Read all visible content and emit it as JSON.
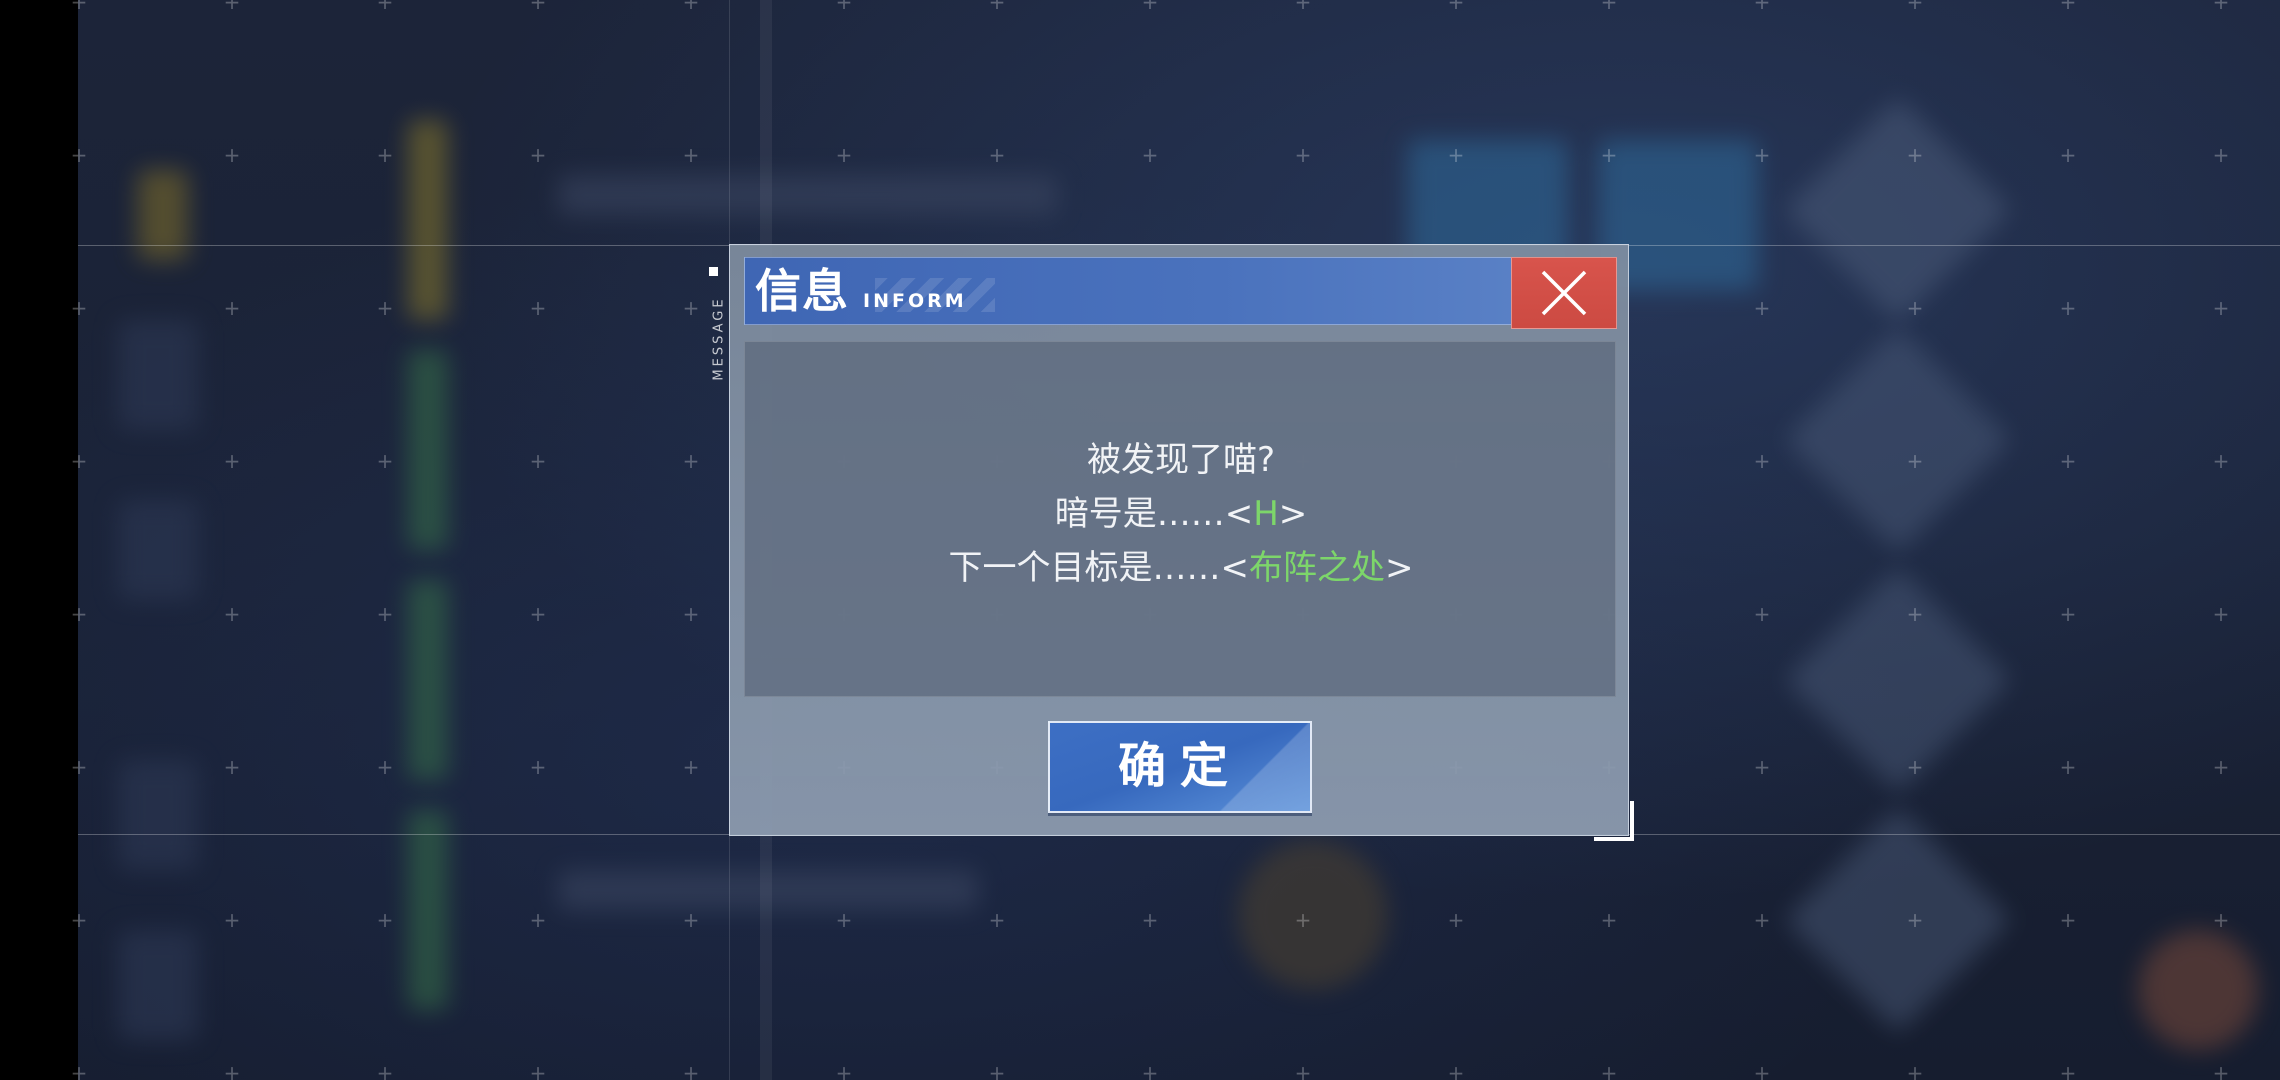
{
  "dialog": {
    "title": "信息",
    "title_sub": "INFORM",
    "side_label": "MESSAGE",
    "close_icon": "close-x-icon",
    "lines": [
      {
        "prefix": "被发现了喵?",
        "highlight": "",
        "suffix": ""
      },
      {
        "prefix": "暗号是……<",
        "highlight": "H",
        "suffix": ">"
      },
      {
        "prefix": "下一个目标是……<",
        "highlight": "布阵之处",
        "suffix": ">"
      }
    ],
    "confirm_label": "确定"
  },
  "colors": {
    "title_bar": "#4a72bd",
    "close_button": "#d8544c",
    "highlight_text": "#7dd66a",
    "confirm_button": "#3d6fc4"
  }
}
